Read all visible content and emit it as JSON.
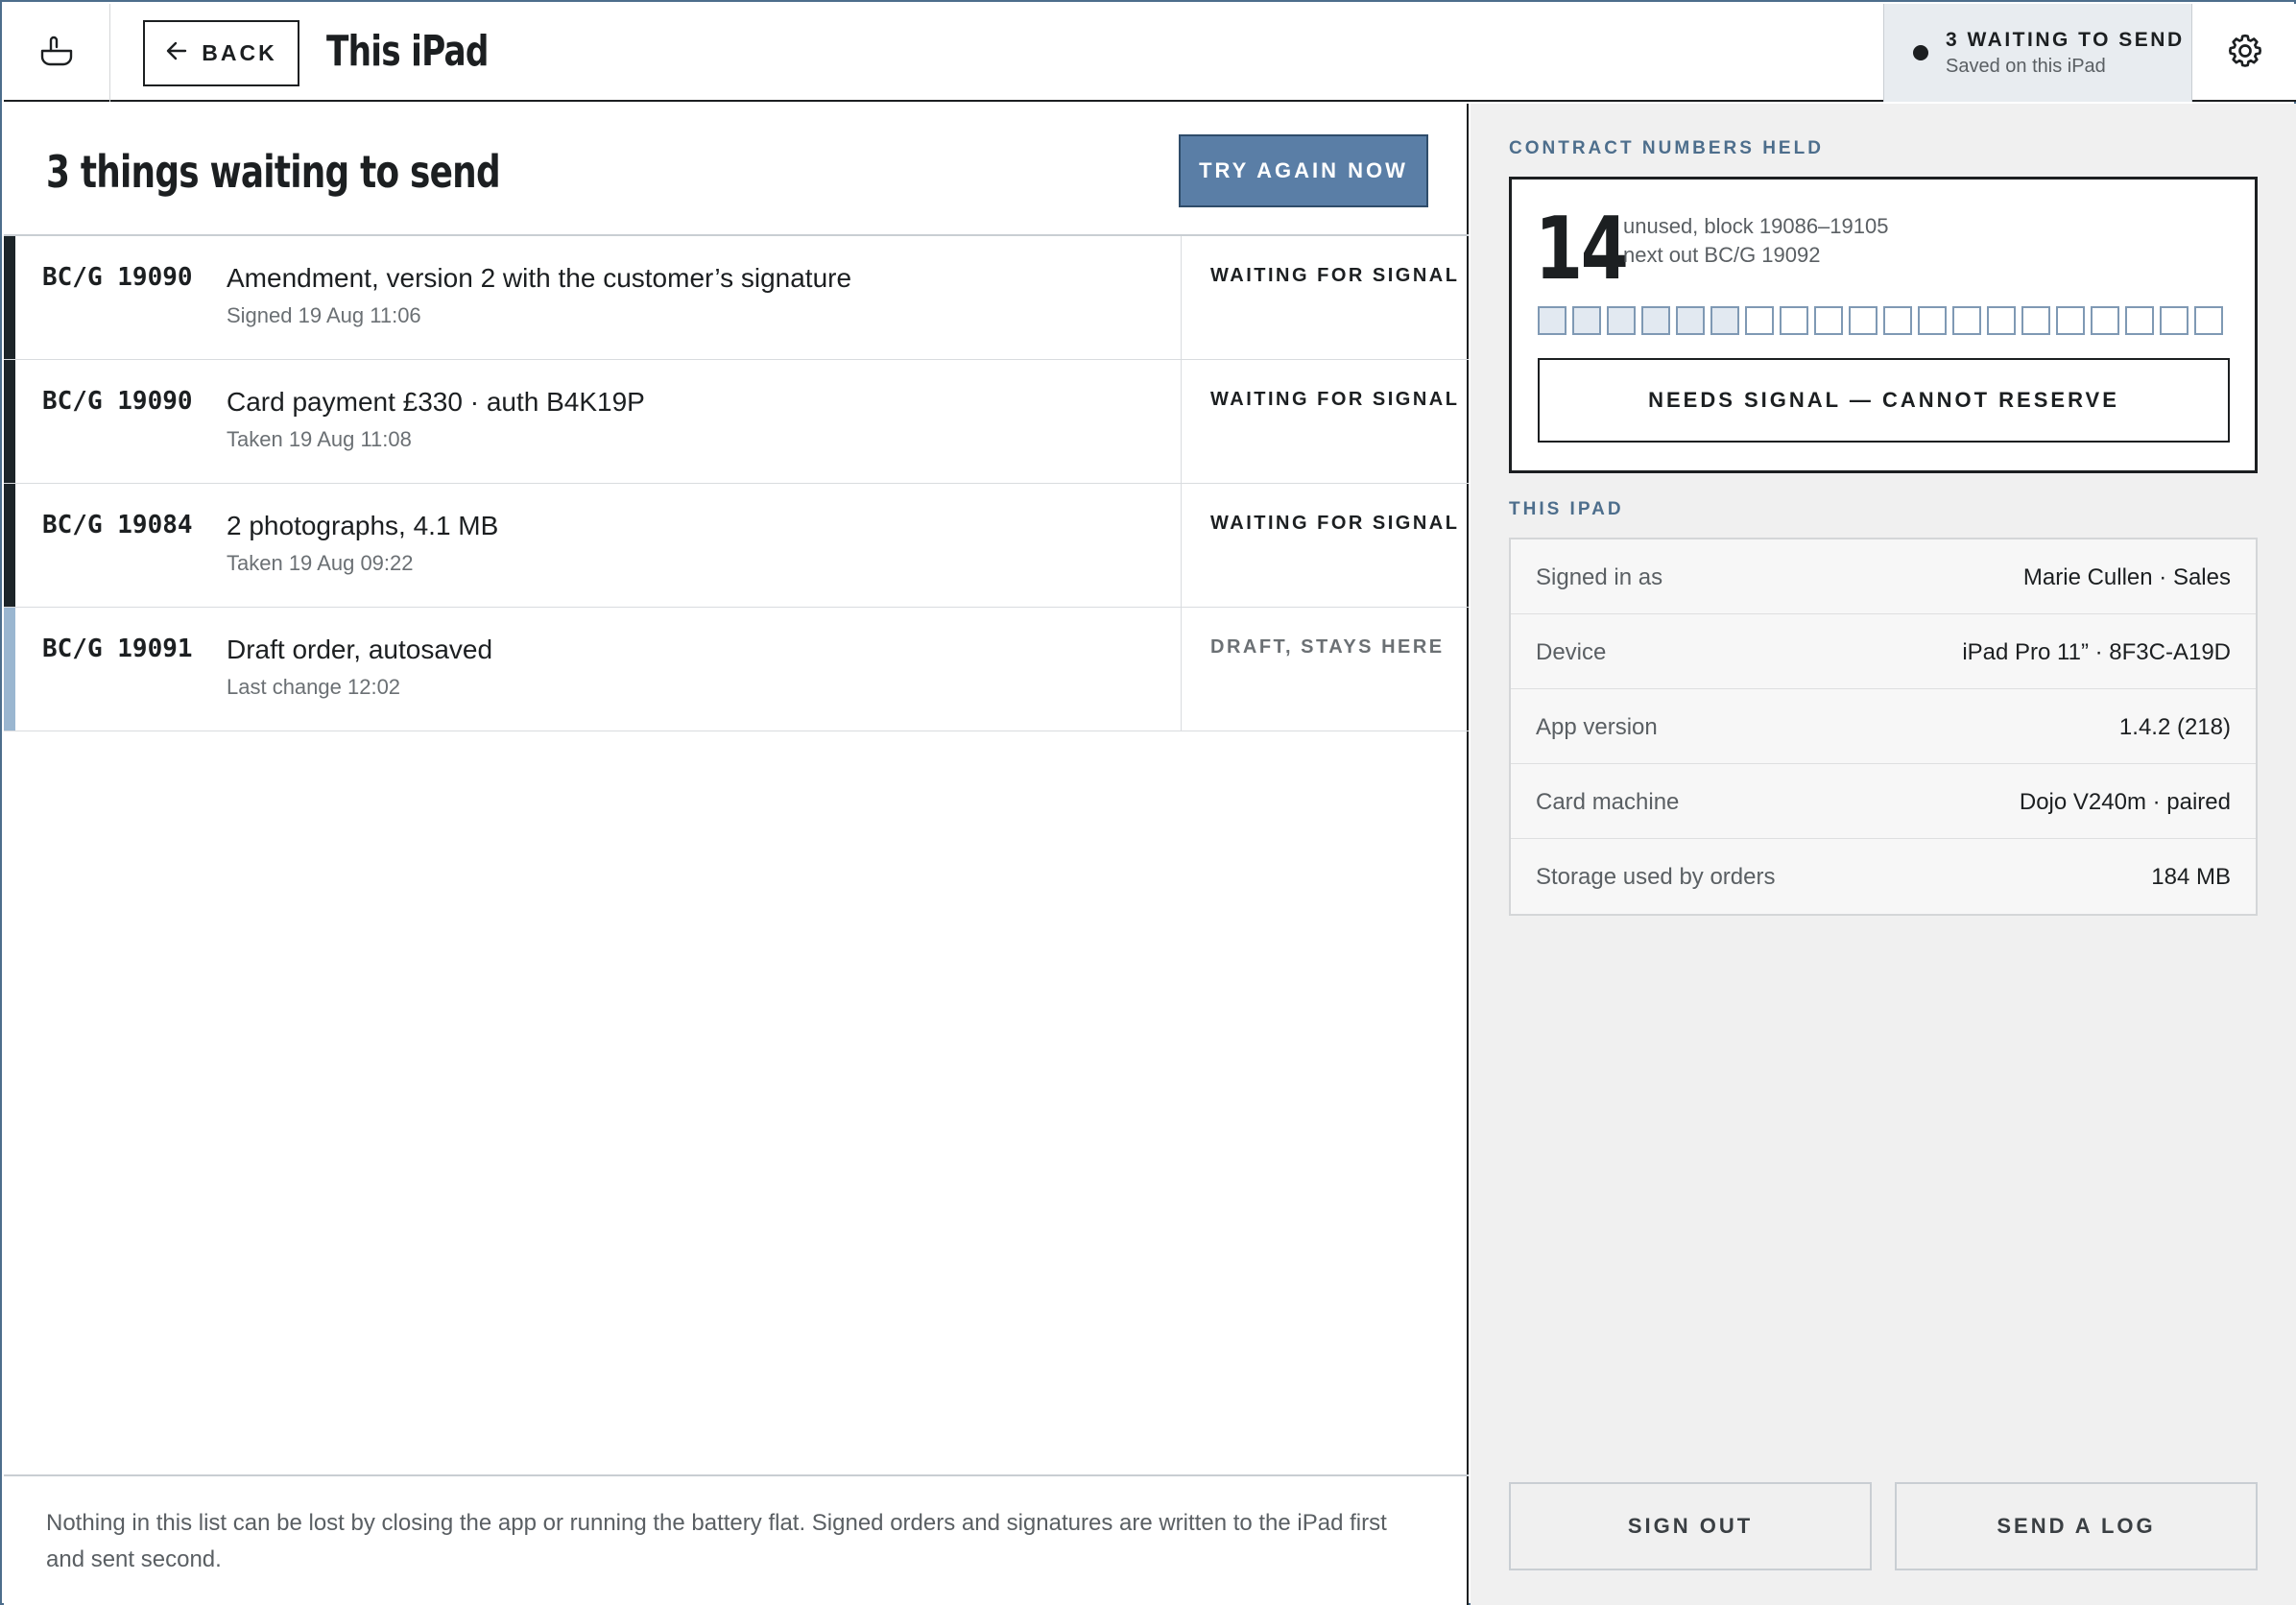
{
  "header": {
    "back_label": "BACK",
    "title": "This iPad",
    "status_title": "3 WAITING TO SEND",
    "status_sub": "Saved on this iPad"
  },
  "main": {
    "title": "3 things waiting to send",
    "try_again_label": "TRY AGAIN NOW",
    "queue": [
      {
        "ref": "BC/G 19090",
        "desc": "Amendment, version 2 with the customer’s signature",
        "when": "Signed 19 Aug 11:06",
        "state": "WAITING FOR SIGNAL"
      },
      {
        "ref": "BC/G 19090",
        "desc": "Card payment £330 · auth B4K19P",
        "when": "Taken 19 Aug 11:08",
        "state": "WAITING FOR SIGNAL"
      },
      {
        "ref": "BC/G 19084",
        "desc": "2 photographs, 4.1 MB",
        "when": "Taken 19 Aug 09:22",
        "state": "WAITING FOR SIGNAL"
      },
      {
        "ref": "BC/G 19091",
        "desc": "Draft order, autosaved",
        "when": "Last change 12:02",
        "state": "DRAFT, STAYS HERE"
      }
    ],
    "footnote": "Nothing in this list can be lost by closing the app or running the battery flat. Signed orders and signatures are written to the iPad first and sent second."
  },
  "side": {
    "contract_label": "CONTRACT NUMBERS HELD",
    "held_count": "14",
    "held_line1": "unused, block 19086–19105",
    "held_line2": "next out BC/G 19092",
    "block_total": 20,
    "block_unused": 14,
    "reserve_label": "NEEDS SIGNAL — CANNOT RESERVE",
    "ipad_label": "THIS IPAD",
    "info": [
      {
        "k": "Signed in as",
        "v": "Marie Cullen · Sales"
      },
      {
        "k": "Device",
        "v": "iPad Pro 11” · 8F3C-A19D"
      },
      {
        "k": "App version",
        "v": "1.4.2 (218)"
      },
      {
        "k": "Card machine",
        "v": "Dojo V240m · paired"
      },
      {
        "k": "Storage used by orders",
        "v": "184 MB"
      }
    ],
    "sign_out_label": "SIGN OUT",
    "send_log_label": "SEND A LOG"
  },
  "colors": {
    "accent": "#5a7ea6",
    "ink": "#1c1f21",
    "draft_bar": "#9ab6d0",
    "panel": "#f0f0f0"
  },
  "icons": {
    "home": "hand-wash-icon",
    "back": "arrow-left-icon",
    "status": "dot-icon",
    "settings": "gear-icon"
  }
}
